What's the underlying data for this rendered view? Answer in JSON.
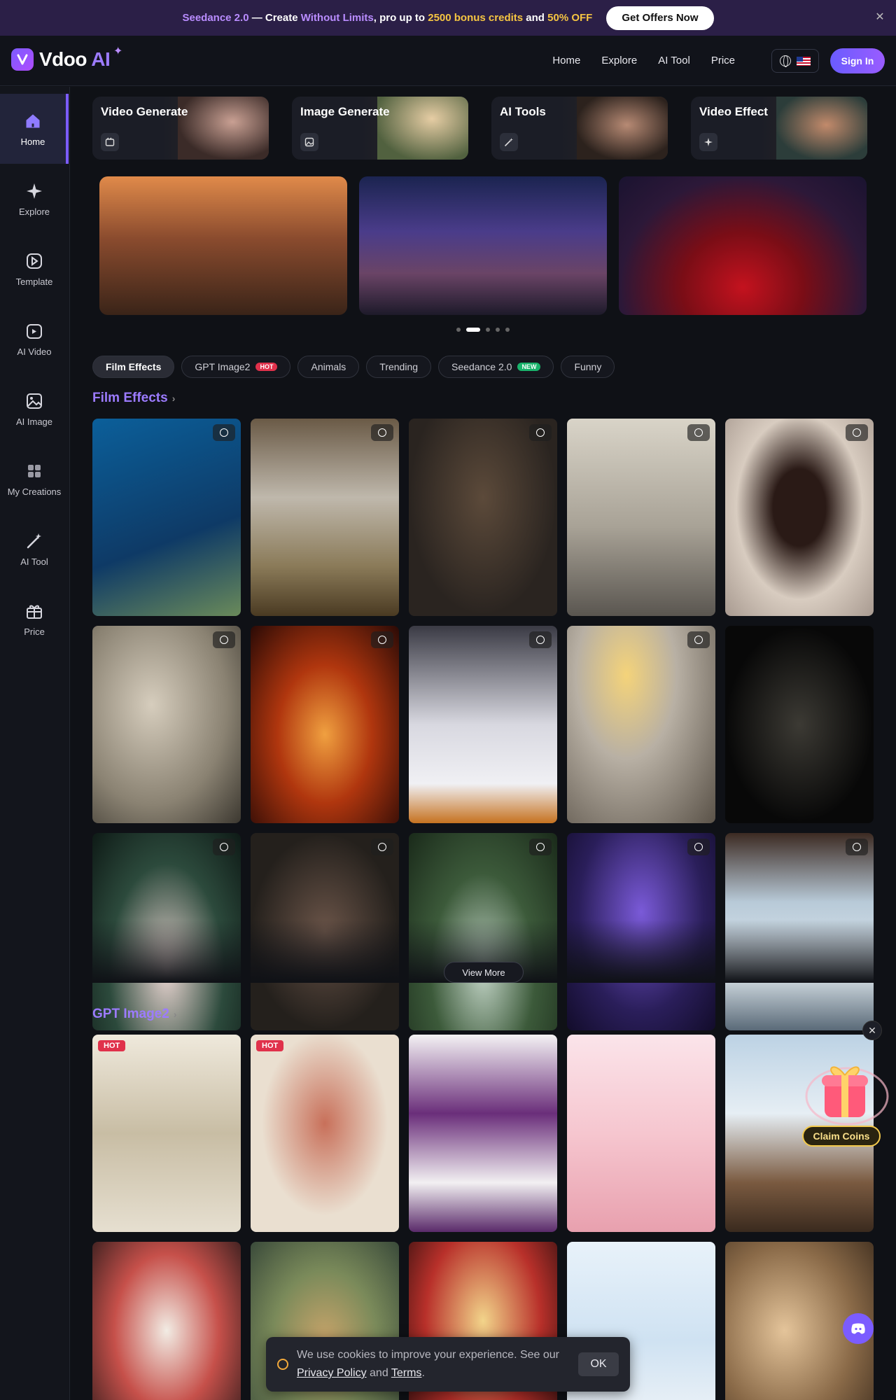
{
  "promo": {
    "brand": "Seedance 2.0",
    "dash": " — Create ",
    "highlight": "Without Limits",
    "mid": ", pro up to ",
    "credits": "2500 bonus credits",
    "and": " and ",
    "discount": "50% OFF",
    "button": "Get Offers Now",
    "close": "✕"
  },
  "header": {
    "logo_text": "Vdoo",
    "logo_ai": " AI",
    "nav": [
      "Home",
      "Explore",
      "AI Tool",
      "Price"
    ],
    "signin": "Sign In"
  },
  "sidebar": {
    "items": [
      {
        "label": "Home",
        "icon": "home-icon"
      },
      {
        "label": "Explore",
        "icon": "sparkle-icon"
      },
      {
        "label": "Template",
        "icon": "template-icon"
      },
      {
        "label": "AI Video",
        "icon": "video-icon"
      },
      {
        "label": "AI Image",
        "icon": "image-icon"
      },
      {
        "label": "My Creations",
        "icon": "grid-icon"
      },
      {
        "label": "AI Tool",
        "icon": "wand-icon"
      },
      {
        "label": "Price",
        "icon": "gift-icon"
      }
    ]
  },
  "categories": [
    {
      "title": "Video Generate",
      "icon": "video-generate-icon"
    },
    {
      "title": "Image Generate",
      "icon": "image-generate-icon"
    },
    {
      "title": "AI Tools",
      "icon": "magic-wand-icon"
    },
    {
      "title": "Video Effect",
      "icon": "effect-icon"
    }
  ],
  "filters": [
    {
      "label": "Film Effects",
      "badge": ""
    },
    {
      "label": "GPT Image2",
      "badge": "HOT"
    },
    {
      "label": "Animals",
      "badge": ""
    },
    {
      "label": "Trending",
      "badge": ""
    },
    {
      "label": "Seedance 2.0",
      "badge": "NEW"
    },
    {
      "label": "Funny",
      "badge": ""
    }
  ],
  "sections": {
    "film_effects": {
      "title": "Film Effects",
      "chev": "›",
      "view_more": "View More"
    },
    "gpt_image2": {
      "title": "GPT Image2",
      "chev": "›",
      "hot_label": "HOT"
    }
  },
  "claim": "Claim Coins",
  "cookie": {
    "pre": "We use cookies to improve your experience. See our ",
    "privacy": "Privacy Policy",
    "and": " and ",
    "terms": "Terms",
    "end": ".",
    "ok": "OK"
  },
  "colors": {
    "accent": "#7b5cff",
    "purple_text": "#9c7bff",
    "gold": "#f5c542",
    "hot": "#e0314b",
    "new": "#19b36b"
  }
}
